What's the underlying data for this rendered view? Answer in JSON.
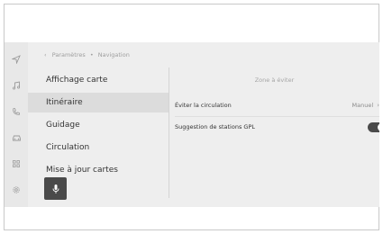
{
  "breadcrumb": {
    "parent": "Paramètres",
    "separator": "•",
    "current": "Navigation"
  },
  "rail_icons": [
    "navigation-arrow-icon",
    "music-note-icon",
    "phone-icon",
    "car-icon",
    "apps-grid-icon",
    "settings-gear-icon"
  ],
  "menu": {
    "items": [
      {
        "label": "Affichage carte",
        "selected": false
      },
      {
        "label": "Itinéraire",
        "selected": true
      },
      {
        "label": "Guidage",
        "selected": false
      },
      {
        "label": "Circulation",
        "selected": false
      },
      {
        "label": "Mise à jour cartes",
        "selected": false
      }
    ]
  },
  "settings": {
    "zone_header": "Zone à éviter",
    "avoid_traffic": {
      "label": "Éviter la circulation",
      "value": "Manuel"
    },
    "gpl_suggestion": {
      "label": "Suggestion de stations GPL",
      "enabled": true
    }
  },
  "colors": {
    "panel_bg": "#eeeeee",
    "selected_bg": "#dcdcdc",
    "toggle_on": "#4a4a4a"
  }
}
